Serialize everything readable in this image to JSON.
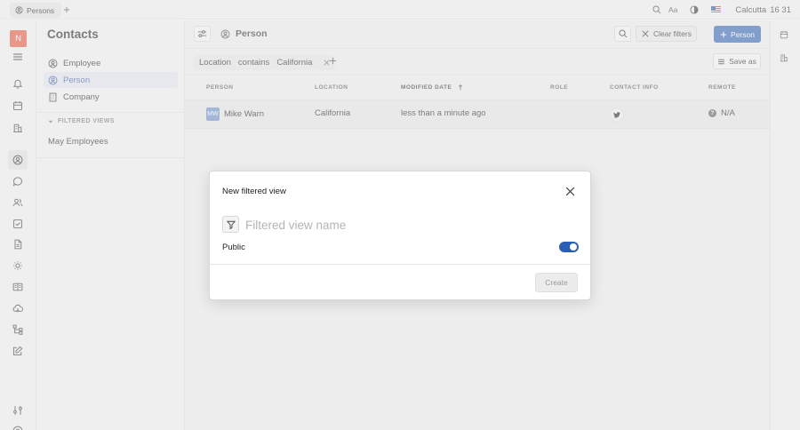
{
  "tabbar": {
    "tab_label": "Persons",
    "add_tab": "+"
  },
  "topbar": {
    "font_label": "Aa",
    "location": "Calcutta",
    "time": "16 31"
  },
  "workspace": {
    "initial": "N",
    "logo_color": "#e8523a"
  },
  "sidebar": {
    "title": "Contacts",
    "items": [
      {
        "label": "Employee",
        "icon": "person-circle-icon"
      },
      {
        "label": "Person",
        "icon": "person-circle-icon",
        "active": true
      },
      {
        "label": "Company",
        "icon": "building-icon"
      }
    ],
    "filtered_views_label": "FILTERED VIEWS",
    "filtered_views": [
      {
        "label": "May Employees"
      }
    ]
  },
  "toolbar": {
    "object_title": "Person",
    "clear_filters_label": "Clear filters",
    "add_person_label": "Person",
    "accent_color": "#2b5fb5"
  },
  "filter": {
    "field": "Location",
    "operator": "contains",
    "value": "California",
    "save_as_label": "Save as"
  },
  "table": {
    "columns": [
      "PERSON",
      "LOCATION",
      "MODIFIED DATE",
      "ROLE",
      "CONTACT INFO",
      "REMOTE"
    ],
    "rows": [
      {
        "avatar_initials": "MW",
        "person": "Mike Warn",
        "location": "California",
        "modified": "less than a minute ago",
        "role": "",
        "contact_icon": "twitter-icon",
        "remote": "N/A"
      }
    ]
  },
  "modal": {
    "title": "New filtered view",
    "name_placeholder": "Filtered view name",
    "name_value": "",
    "public_label": "Public",
    "public_enabled": true,
    "create_label": "Create"
  }
}
